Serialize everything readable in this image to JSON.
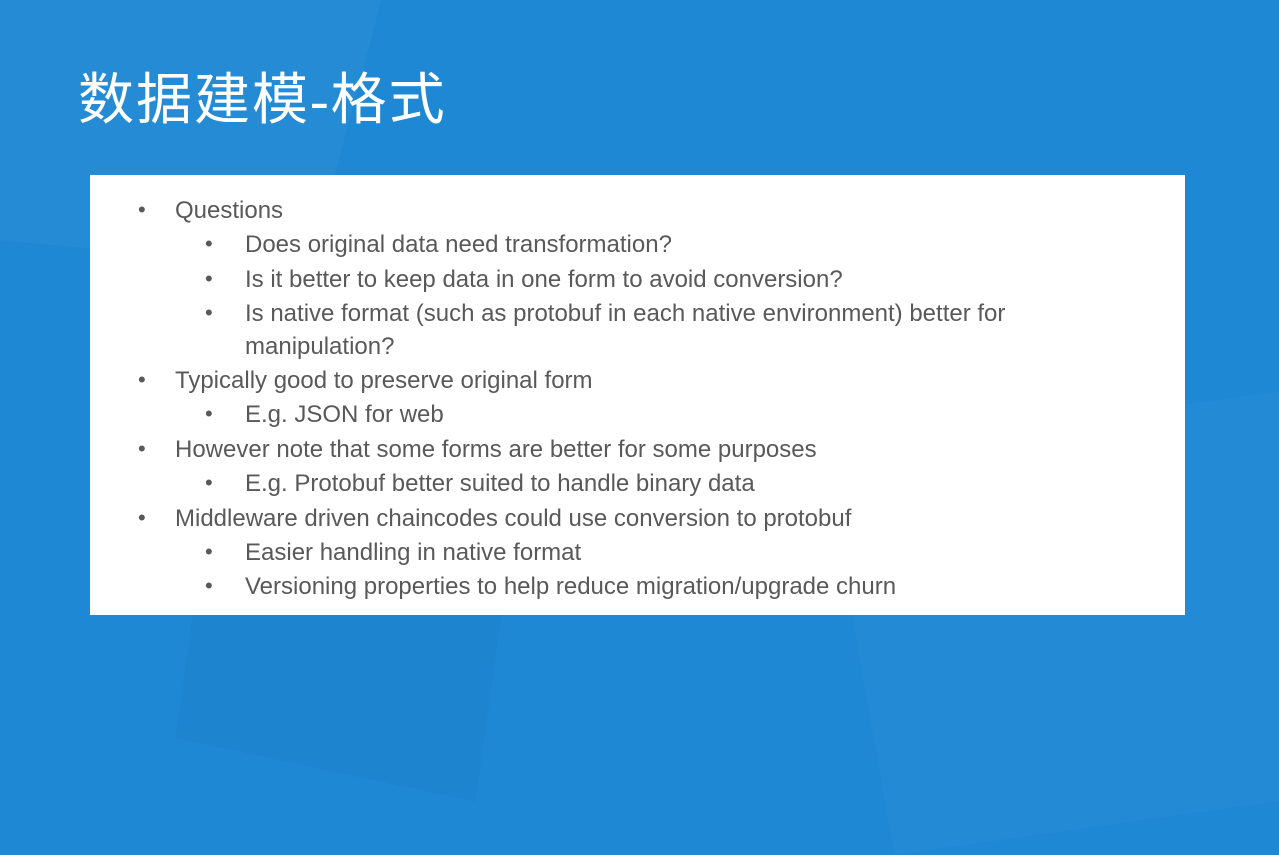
{
  "title": "数据建模-格式",
  "bullets": [
    {
      "text": "Questions",
      "sub": [
        "Does original data need transformation?",
        "Is it better to keep data in one form to avoid conversion?",
        "Is native format (such as protobuf in each native environment) better for manipulation?"
      ]
    },
    {
      "text": "Typically good to preserve original form",
      "sub": [
        "E.g. JSON for web"
      ]
    },
    {
      "text": "However note that some forms are better for some purposes",
      "sub": [
        "E.g. Protobuf better suited to handle binary data"
      ]
    },
    {
      "text": "Middleware driven chaincodes could use conversion to protobuf",
      "sub": [
        "Easier handling in native format",
        "Versioning properties to help reduce migration/upgrade churn"
      ]
    }
  ]
}
